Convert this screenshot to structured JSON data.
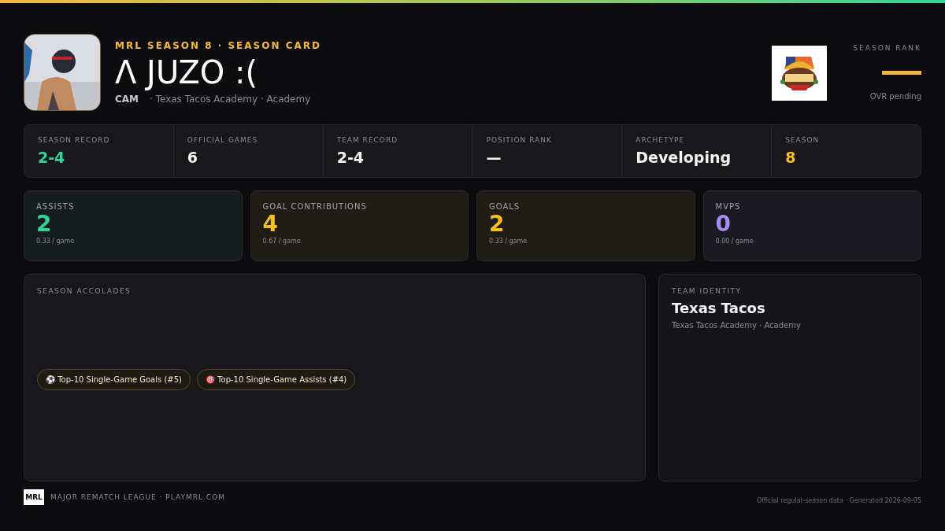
{
  "header": {
    "eyebrow": "MRL SEASON 8 · SEASON CARD",
    "player_name": "Λ JUZO :(",
    "position": "CAM",
    "affiliation": "· Texas Tacos Academy · Academy",
    "rank": {
      "label": "SEASON RANK",
      "note": "OVR pending"
    }
  },
  "summary": [
    {
      "label": "SEASON RECORD",
      "value": "2-4",
      "color": "#34d399"
    },
    {
      "label": "OFFICIAL GAMES",
      "value": "6",
      "color": "#f4f4f5"
    },
    {
      "label": "TEAM RECORD",
      "value": "2-4",
      "color": "#f4f4f5"
    },
    {
      "label": "POSITION RANK",
      "value": "—",
      "color": "#f4f4f5"
    },
    {
      "label": "ARCHETYPE",
      "value": "Developing",
      "color": "#f4f4f5"
    },
    {
      "label": "SEASON",
      "value": "8",
      "color": "#fbbf24"
    }
  ],
  "stats": [
    {
      "label": "ASSISTS",
      "value": "2",
      "rate": "0.33 / game",
      "color": "#34d399"
    },
    {
      "label": "GOAL CONTRIBUTIONS",
      "value": "4",
      "rate": "0.67 / game",
      "color": "#fbbf24"
    },
    {
      "label": "GOALS",
      "value": "2",
      "rate": "0.33 / game",
      "color": "#fbbf24"
    },
    {
      "label": "MVPS",
      "value": "0",
      "rate": "0.00 / game",
      "color": "#a78bfa"
    }
  ],
  "accolades": {
    "title": "SEASON ACCOLADES",
    "items": [
      {
        "icon": "⚽",
        "text": "Top-10 Single-Game Goals (#5)"
      },
      {
        "icon": "🎯",
        "text": "Top-10 Single-Game Assists (#4)"
      }
    ]
  },
  "team_identity": {
    "title": "TEAM IDENTITY",
    "name": "Texas Tacos",
    "detail": "Texas Tacos Academy · Academy"
  },
  "footer": {
    "logo_text": "MRL",
    "league": "MAJOR REMATCH LEAGUE · PLAYMRL.COM",
    "note": "Official regular-season data · Generated 2026-09-05"
  }
}
